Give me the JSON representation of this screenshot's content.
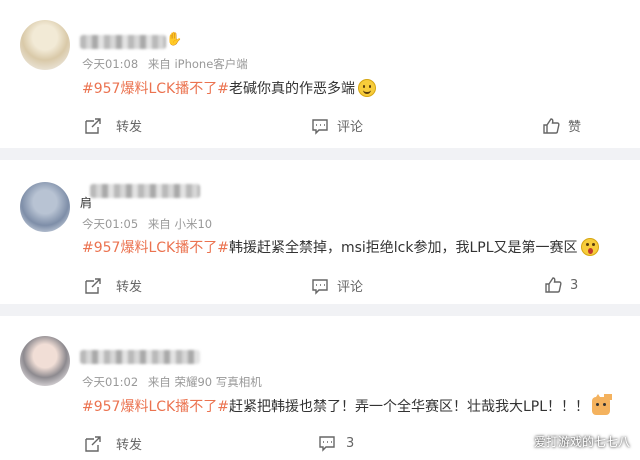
{
  "posts": [
    {
      "time": "今天01:08",
      "source": "来自 iPhone客户端",
      "hashtag": "#957爆料LCK播不了#",
      "text": "老碱你真的作恶多端",
      "emoji": "smile-emoji",
      "actions": {
        "repost": "转发",
        "comment": "评论",
        "like": "赞"
      }
    },
    {
      "time": "今天01:05",
      "source": "来自 小米10",
      "name_visible": "肩",
      "hashtag": "#957爆料LCK播不了#",
      "text": "韩援赶紧全禁掉，msi拒绝lck参加，我LPL又是第一赛区",
      "emoji": "shocked-emoji",
      "actions": {
        "repost": "转发",
        "comment": "评论",
        "like_count": "3"
      }
    },
    {
      "time": "今天01:02",
      "source": "来自 荣耀90 写真相机",
      "hashtag": "#957爆料LCK播不了#",
      "text": "赶紧把韩援也禁了！弄一个全华赛区！壮哉我大LPL！！！",
      "emoji": "cat-emoji",
      "actions": {
        "repost": "转发",
        "comment_count": "3"
      }
    }
  ],
  "watermark": "爱打游戏的七七八",
  "colors": {
    "hashtag": "#eb7350",
    "divider": "#f1f2f5",
    "meta": "#999999"
  }
}
